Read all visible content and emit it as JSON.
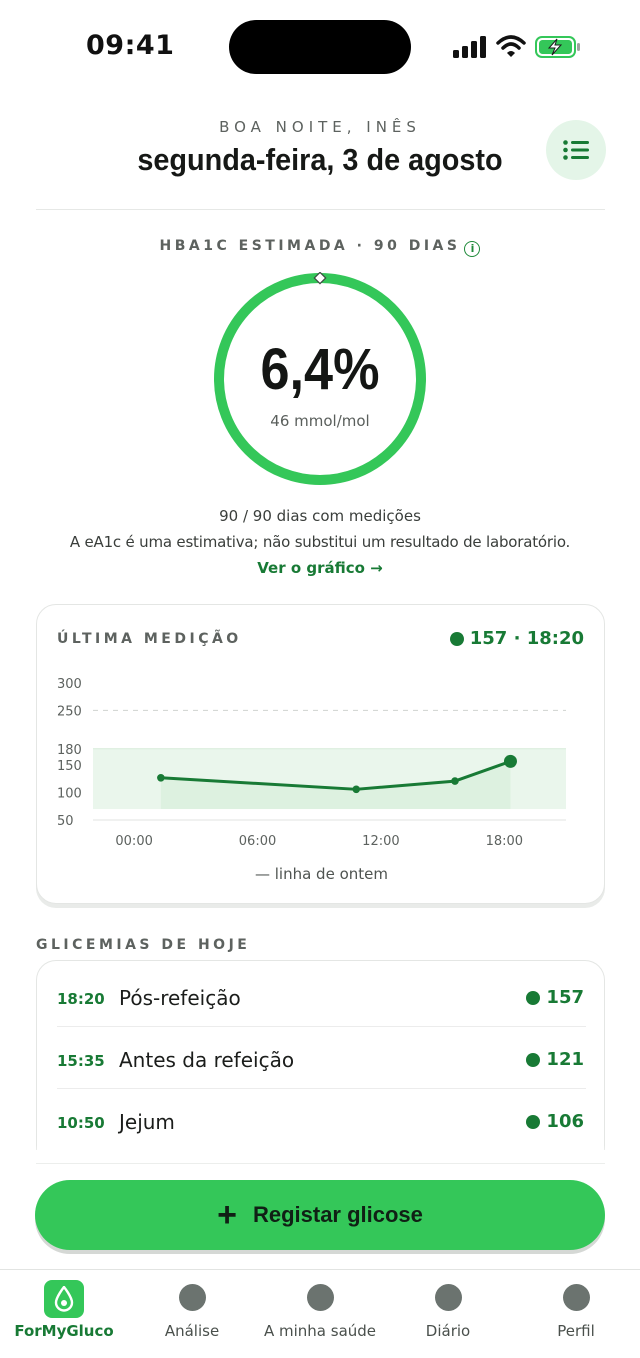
{
  "status_bar": {
    "time": "09:41"
  },
  "header": {
    "greeting": "BOA NOITE, INÊS",
    "date": "segunda-feira, 3 de agosto",
    "menu_icon": "list-icon"
  },
  "hba1c": {
    "label": "HBA1C ESTIMADA · 90 DIAS",
    "info_icon": "info-icon",
    "value": "6,4%",
    "sub_value": "46 mmol/mol",
    "progress": 1.0,
    "days_text": "90 / 90 dias com medições",
    "disclaimer": "A eA1c é uma estimativa; não substitui um resultado de laboratório.",
    "link": "Ver o gráfico →",
    "accent_color": "#34c759"
  },
  "last_measurement": {
    "title": "ÚLTIMA MEDIÇÃO",
    "reading": "157 · 18:20",
    "legend": "— linha de ontem"
  },
  "chart_data": {
    "type": "line",
    "y_ticks": [
      "300",
      "250",
      "180",
      "150",
      "100",
      "50"
    ],
    "x_ticks": [
      "00:00",
      "06:00",
      "12:00",
      "18:00"
    ],
    "ylim": [
      50,
      300
    ],
    "xlim": [
      -2,
      21
    ],
    "target_range": [
      70,
      180
    ],
    "reference_line": 250,
    "series": [
      {
        "x": [
          1.3,
          10.8,
          15.6,
          18.3
        ],
        "y": [
          127,
          106,
          121,
          157
        ]
      }
    ]
  },
  "today": {
    "section_label": "GLICEMIAS DE HOJE",
    "rows": [
      {
        "time": "18:20",
        "label": "Pós-refeição",
        "value": "157"
      },
      {
        "time": "15:35",
        "label": "Antes da refeição",
        "value": "121"
      },
      {
        "time": "10:50",
        "label": "Jejum",
        "value": "106"
      }
    ]
  },
  "cta": {
    "label": "Registar glicose",
    "icon": "plus-icon"
  },
  "tabs": [
    {
      "label": "ForMyGluco",
      "active": true,
      "icon": "drop-icon"
    },
    {
      "label": "Análise",
      "active": false,
      "icon": "analysis-icon"
    },
    {
      "label": "A minha saúde",
      "active": false,
      "icon": "health-icon"
    },
    {
      "label": "Diário",
      "active": false,
      "icon": "diary-icon"
    },
    {
      "label": "Perfil",
      "active": false,
      "icon": "profile-icon"
    }
  ],
  "colors": {
    "brand_green": "#34c759",
    "dark_green": "#187a35"
  }
}
